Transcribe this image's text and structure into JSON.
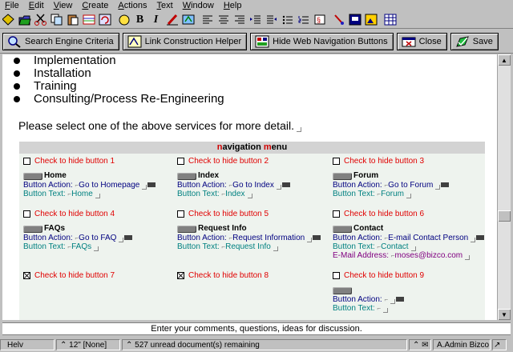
{
  "menu": [
    "File",
    "Edit",
    "View",
    "Create",
    "Actions",
    "Text",
    "Window",
    "Help"
  ],
  "toolbar_icons": [
    "diamond-icon",
    "open-icon",
    "cut-icon",
    "copy-icon",
    "paste-icon",
    "table-icon",
    "refresh-icon",
    "smartcopy-icon",
    "bold-icon",
    "italic-icon",
    "highlight-icon",
    "style-icon",
    "align-left-icon",
    "align-center-icon",
    "align-right-icon",
    "indent-icon",
    "outdent-icon",
    "bullets-icon",
    "numbers-icon",
    "properties-icon",
    "link-icon",
    "sound-icon",
    "image-icon",
    "table-insert-icon"
  ],
  "toolbar_text": {
    "bold": "B",
    "italic": "I"
  },
  "actions": [
    {
      "label": "Search Engine Criteria",
      "icon": "search-engine-icon"
    },
    {
      "label": "Link Construction Helper",
      "icon": "link-helper-icon"
    },
    {
      "label": "Hide Web Navigation Buttons",
      "icon": "nav-buttons-icon"
    },
    {
      "label": "Close",
      "icon": "close-icon"
    },
    {
      "label": "Save",
      "icon": "save-icon"
    }
  ],
  "services": [
    "Implementation",
    "Installation",
    "Training",
    "Consulting/Process Re-Engineering"
  ],
  "prompt": "Please select one of the above services for more detail.",
  "nav": {
    "title_parts": [
      "n",
      "avigation ",
      "m",
      "enu"
    ],
    "cells": [
      {
        "hide": "Check to hide button 1",
        "checked": false,
        "name": "Home",
        "action_label": "Button Action:",
        "action": "Go to Homepage",
        "text_label": "Button Text:",
        "text": "Home"
      },
      {
        "hide": "Check to hide button 2",
        "checked": false,
        "name": "Index",
        "action_label": "Button Action:",
        "action": "Go to Index",
        "text_label": "Button Text:",
        "text": "Index"
      },
      {
        "hide": "Check to hide button 3",
        "checked": false,
        "name": "Forum",
        "action_label": "Button Action:",
        "action": "Go to Forum",
        "text_label": "Button Text:",
        "text": "Forum"
      },
      {
        "hide": "Check to hide button 4",
        "checked": false,
        "name": "FAQs",
        "action_label": "Button Action:",
        "action": "Go to FAQ",
        "text_label": "Button Text:",
        "text": "FAQs"
      },
      {
        "hide": "Check to hide button 5",
        "checked": false,
        "name": "Request Info",
        "action_label": "Button Action:",
        "action": "Request Information",
        "text_label": "Button Text:",
        "text": "Request Info"
      },
      {
        "hide": "Check to hide button 6",
        "checked": false,
        "name": "Contact",
        "action_label": "Button Action:",
        "action": "E-mail Contact Person",
        "text_label": "Button Text:",
        "text": "Contact",
        "email_label": "E-Mail Address:",
        "email": "moses@bizco.com"
      },
      {
        "hide": "Check to hide button 7",
        "checked": true
      },
      {
        "hide": "Check to hide button 8",
        "checked": true
      },
      {
        "hide": "Check to hide button 9",
        "checked": false,
        "name": "",
        "action_label": "Button Action:",
        "action": "",
        "text_label": "Button Text:",
        "text": ""
      }
    ]
  },
  "footer": "Enter your comments, questions, ideas for discussion.",
  "status": {
    "font": "Helv",
    "size": "12\"",
    "style": "[None]",
    "message": "527 unread document(s) remaining",
    "user": "A.Admin Bizco"
  },
  "colors": {
    "nav_bg": "#eef3ee",
    "hide_text": "#e00000",
    "action_text": "#000080",
    "button_text": "#008080",
    "email_text": "#800080"
  }
}
